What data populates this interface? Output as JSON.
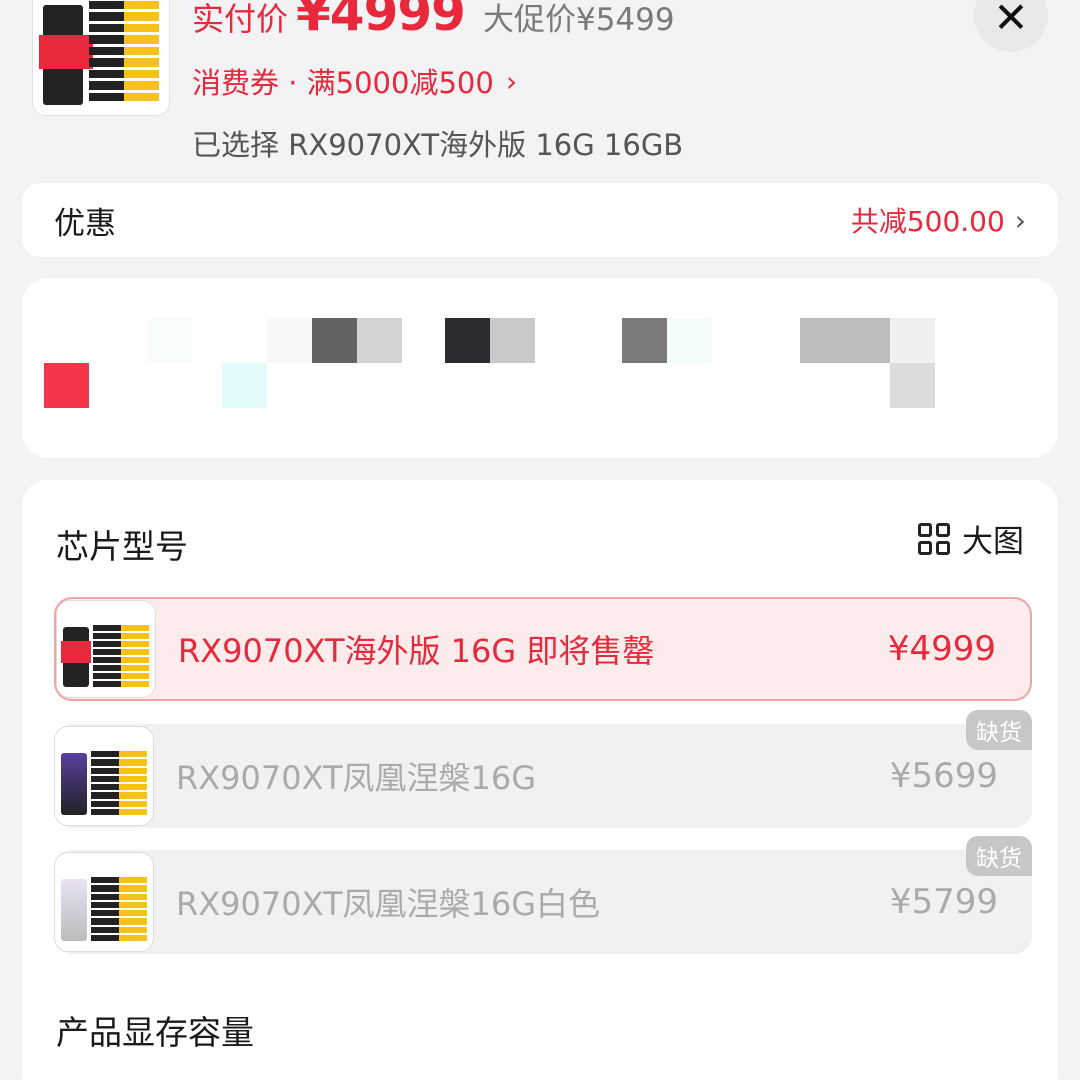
{
  "header": {
    "price_label": "实付价",
    "price_value": "¥4999",
    "promo_price": "大促价¥5499",
    "coupon_text": "消费券 · 满5000减500",
    "selected_text": "已选择 RX9070XT海外版 16G 16GB"
  },
  "offer": {
    "title": "优惠",
    "total_discount": "共减500.00"
  },
  "chip_section": {
    "title": "芯片型号",
    "big_image_label": "大图",
    "options": [
      {
        "label": "RX9070XT海外版 16G 即将售罄",
        "price": "¥4999",
        "selected": true
      },
      {
        "label": "RX9070XT凤凰涅槃16G",
        "price": "¥5699",
        "badge": "缺货"
      },
      {
        "label": "RX9070XT凤凰涅槃16G白色",
        "price": "¥5799",
        "badge": "缺货"
      }
    ]
  },
  "memory_section": {
    "title": "产品显存容量"
  },
  "colors": {
    "accent": "#e8283b",
    "background": "#f3f3f5",
    "disabled_text": "#aaaaaa",
    "badge": "#c7c7c9"
  },
  "icons": {
    "close": "close-icon",
    "chevron": "chevron-right-icon",
    "grid": "grid-icon"
  }
}
